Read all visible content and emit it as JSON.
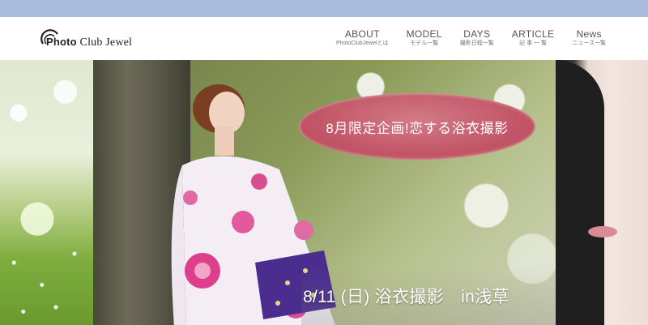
{
  "site": {
    "logo_prefix": "Photo",
    "logo_name": "Club Jewel"
  },
  "nav": {
    "items": [
      {
        "label": "ABOUT",
        "sub": "PhotoClubJewelとは"
      },
      {
        "label": "MODEL",
        "sub": "モデル一覧"
      },
      {
        "label": "DAYS",
        "sub": "撮影日程一覧"
      },
      {
        "label": "ARTICLE",
        "sub": "記 事 一 覧"
      },
      {
        "label": "News",
        "sub": "ニュース一覧"
      }
    ]
  },
  "hero": {
    "badge": "8月限定企画!恋する浴衣撮影",
    "caption": "8/11 (日) 浴衣撮影　in浅草"
  },
  "colors": {
    "topbar": "#a9bcdc",
    "badge": "#c25667"
  }
}
